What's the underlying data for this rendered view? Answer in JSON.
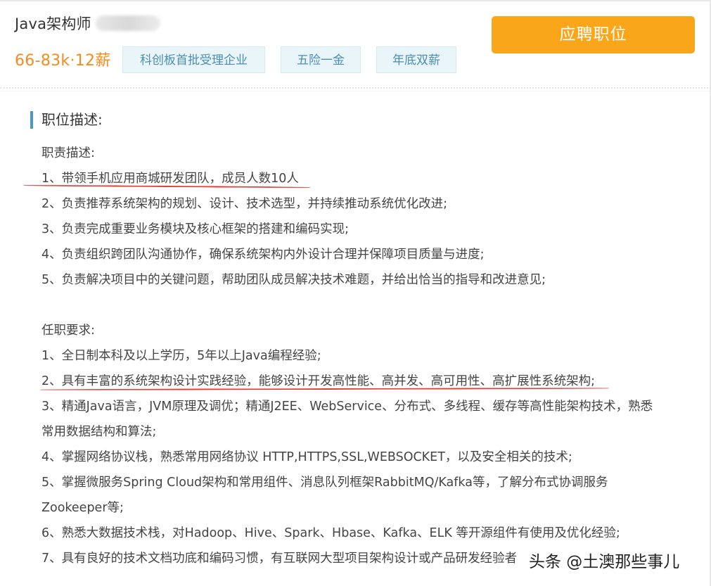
{
  "header": {
    "job_title": "Java架构师",
    "salary": "66-83k·12薪",
    "tags": [
      "科创板首批受理企业",
      "五险一金",
      "年底双薪"
    ],
    "apply_label": "应聘职位"
  },
  "section": {
    "title": "职位描述:"
  },
  "responsibilities": {
    "heading": "职责描述:",
    "items": [
      "1、带领手机应用商城研发团队，成员人数10人",
      "2、负责推荐系统架构的规划、设计、技术选型，并持续推动系统优化改进;",
      "3、负责完成重要业务模块及核心框架的搭建和编码实现;",
      "4、负责组织跨团队沟通协作，确保系统架构内外设计合理并保障项目质量与进度;",
      "5、负责解决项目中的关键问题，帮助团队成员解决技术难题，并给出恰当的指导和改进意见;"
    ]
  },
  "requirements": {
    "heading": "任职要求:",
    "items": [
      "1、全日制本科及以上学历，5年以上Java编程经验;",
      "2、具有丰富的系统架构设计实践经验，能够设计开发高性能、高并发、高可用性、高扩展性系统架构;",
      "3、精通Java语言，JVM原理及调优；精通J2EE、WebService、分布式、多线程、缓存等高性能架构技术，熟悉",
      "常用数据结构和算法;",
      "4、掌握网络协议栈，熟悉常用网络协议 HTTP,HTTPS,SSL,WEBSOCKET，以及安全相关的技术;",
      "5、掌握微服务Spring Cloud架构和常用组件、消息队列框架RabbitMQ/Kafka等，了解分布式协调服务",
      "Zookeeper等;",
      "6、熟悉大数据技术栈，对Hadoop、Hive、Spark、Hbase、Kafka、ELK 等开源组件有使用及优化经验;",
      "7、具有良好的技术文档功底和编码习惯，有互联网大型项目架构设计或产品研发经验者"
    ]
  },
  "watermark": "头条 @土澳那些事儿",
  "colors": {
    "salary": "#f78c1e",
    "apply_button": "#f9a61a",
    "tag_background": "#eaf5fa",
    "tag_text": "#4a8eb3",
    "section_accent": "#4e99c4",
    "annotation_underline": "#e53935"
  }
}
